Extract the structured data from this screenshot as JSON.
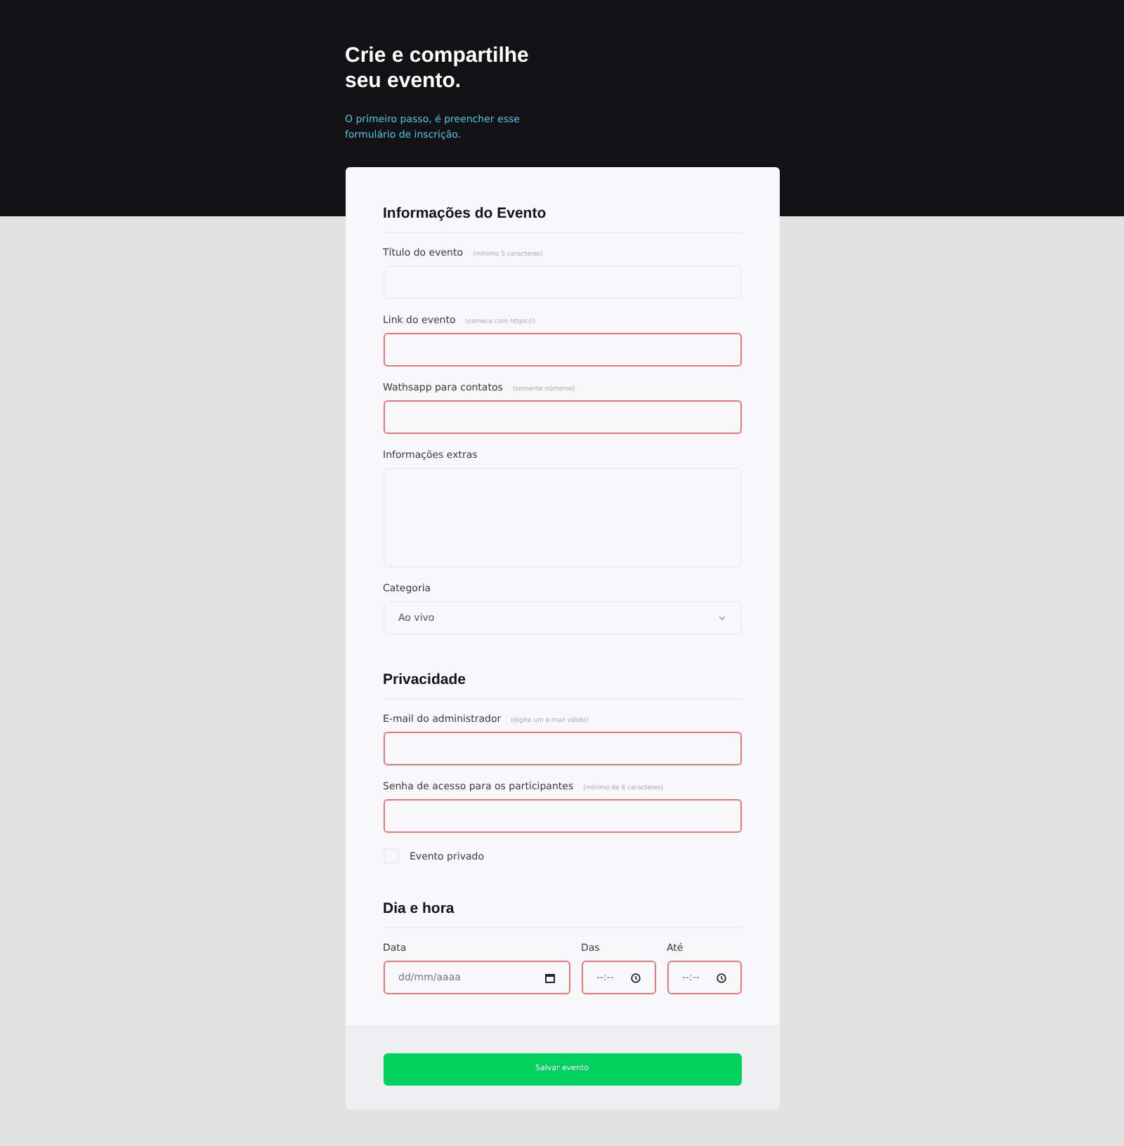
{
  "header": {
    "title": [
      "Crie e compartilhe",
      "seu evento."
    ],
    "subtitle": [
      "O primeiro passo, é preencher esse",
      "formulário de inscrição."
    ]
  },
  "sections": [
    {
      "title": "Informações do Evento",
      "kind": "stack",
      "fields": [
        {
          "kind": "text",
          "label": "Título do evento",
          "hint": "(mínimo 5 caracteres)",
          "invalid": false
        },
        {
          "kind": "text",
          "label": "Link do evento",
          "hint": "(comece com https://)",
          "invalid": true
        },
        {
          "kind": "text",
          "label": "Wathsapp para contatos",
          "hint": "(somente números)",
          "invalid": true
        },
        {
          "kind": "textarea",
          "label": "Informações extras",
          "invalid": false
        },
        {
          "kind": "select",
          "label": "Categoria",
          "value": "Ao vivo",
          "invalid": false
        }
      ]
    },
    {
      "title": "Privacidade",
      "kind": "stack",
      "fields": [
        {
          "kind": "text",
          "label": "E-mail do administrador",
          "hint": "(digite um e-mail válido)",
          "invalid": true
        },
        {
          "kind": "text",
          "label": "Senha de acesso para os participantes",
          "hint": "(mínimo de 6 caracteres)",
          "invalid": true
        },
        {
          "kind": "checkbox",
          "label": "Evento privado",
          "checked": false
        }
      ]
    },
    {
      "title": "Dia e hora",
      "kind": "row",
      "fields": [
        {
          "kind": "date",
          "label": "Data",
          "placeholder": "dd/mm/aaaa",
          "invalid": true
        },
        {
          "kind": "time",
          "label": "Das",
          "placeholder": "--:--",
          "invalid": true
        },
        {
          "kind": "time",
          "label": "Até",
          "placeholder": "--:--",
          "invalid": true
        }
      ]
    }
  ],
  "submit": {
    "label": "Salvar evento"
  }
}
